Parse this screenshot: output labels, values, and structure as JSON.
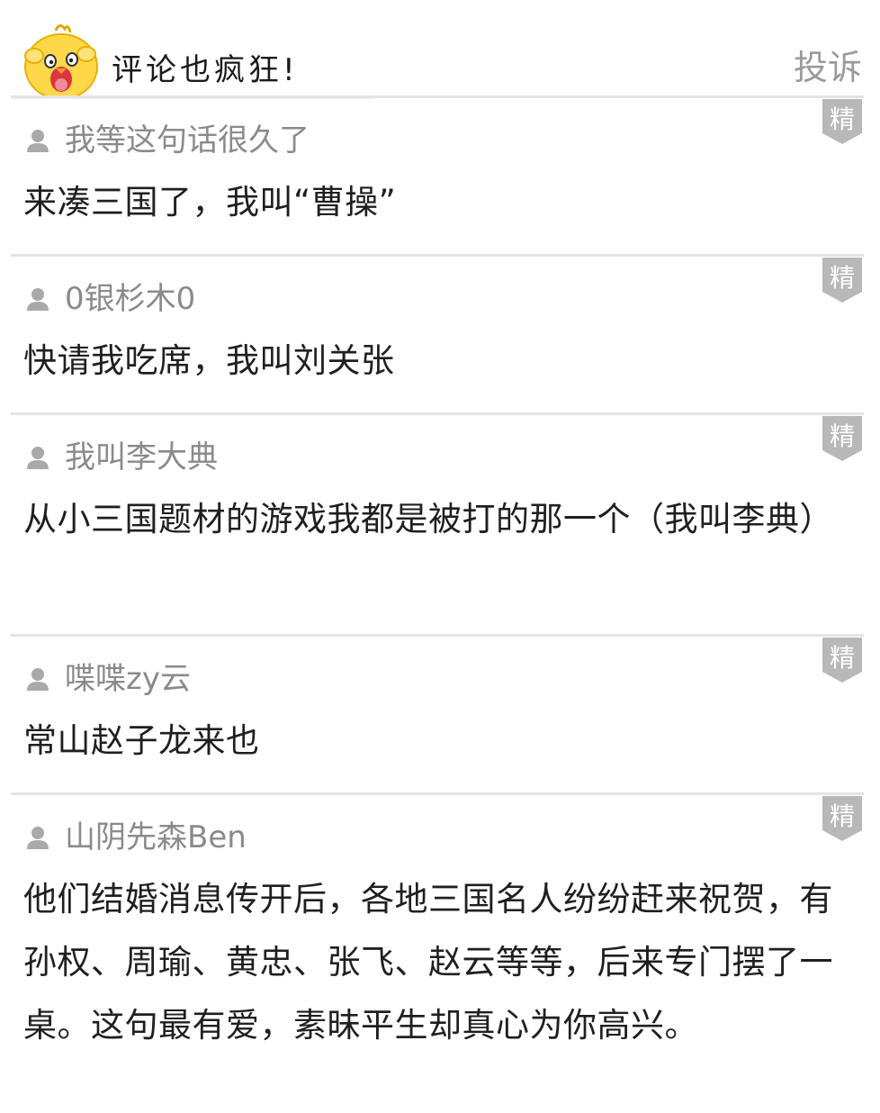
{
  "header": {
    "title": "评论也疯狂!",
    "report_label": "投诉"
  },
  "badge_label": "精",
  "colors": {
    "accent_yellow": "#FFD84A",
    "badge_gray": "#B8B8B8",
    "author_gray": "#8a8a8a",
    "separator": "#e4e4e4"
  },
  "icons": {
    "user": "user-icon",
    "featured": "featured-badge-icon",
    "mascot": "mascot-icon"
  },
  "comments": [
    {
      "author": "我等这句话很久了",
      "text": "来凑三国了，我叫“曹操”"
    },
    {
      "author": "0银杉木0",
      "text": "快请我吃席，我叫刘关张"
    },
    {
      "author": "我叫李大典",
      "text": "从小三国题材的游戏我都是被打的那一个（我叫李典）"
    },
    {
      "author": "喋喋zy云",
      "text": "常山赵子龙来也"
    },
    {
      "author": "山阴先森Ben",
      "text": "他们结婚消息传开后，各地三国名人纷纷赶来祝贺，有孙权、周瑜、黄忠、张飞、赵云等等，后来专门摆了一桌。这句最有爱，素昧平生却真心为你高兴。"
    }
  ]
}
